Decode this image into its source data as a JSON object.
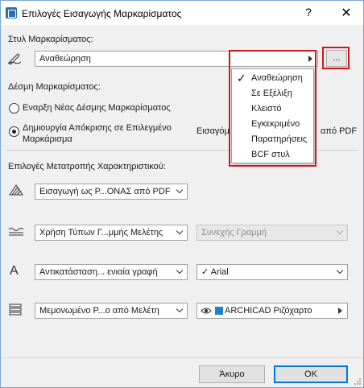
{
  "window": {
    "title": "Επιλογές Εισαγωγής Μαρκαρίσματος",
    "help_glyph": "?",
    "close_glyph": "✕"
  },
  "markup_style": {
    "label": "Στυλ Μαρκαρίσματος:",
    "value": "Αναθεώρηση",
    "more_button": "...",
    "options": [
      "Αναθεώρηση",
      "Σε Εξέλιξη",
      "Κλειστό",
      "Εγκεκριμένο",
      "Παρατηρήσεις",
      "BCF στυλ"
    ],
    "selected_index": 0,
    "check_glyph": "✓"
  },
  "markup_set": {
    "label": "Δέσμη Μαρκαρίσματος:",
    "radio_new": "Εναρξη Νέας Δέσμης Μαρκαρίσματος",
    "radio_reply_line1": "Δημιουργία Απόκρισης σε Επιλεγμένο",
    "radio_reply_line2": "Μαρκάρισμα",
    "reply_value_left": "Εισαγόμ",
    "reply_value_right": "από PDF",
    "selected": "reply"
  },
  "attributes": {
    "label": "Επιλογές Μετατροπής Χαρακτηριστικού:",
    "fill_value": "Εισαγωγή ως Ρ...ΟΝΑΣ από PDF",
    "line_value": "Χρήση Τύπων Γ...μμής Μελέτης",
    "line_type_value": "Συνεχής Γραμμή",
    "font_value": "Αντικατάσταση... ενιαία γραφή",
    "font_name": "Arial",
    "font_check": "✓",
    "layer_value": "Μεμονωμένο Ρ...ο από Μελέτη",
    "layer_name": "ARCHICAD Ριζόχαρτο",
    "text_icon_glyph": "A"
  },
  "buttons": {
    "cancel": "Άκυρο",
    "ok": "OK"
  },
  "colors": {
    "highlight_red": "#d2151b",
    "accent_blue": "#0078d7",
    "layer_icon_blue": "#1f7fc9"
  }
}
